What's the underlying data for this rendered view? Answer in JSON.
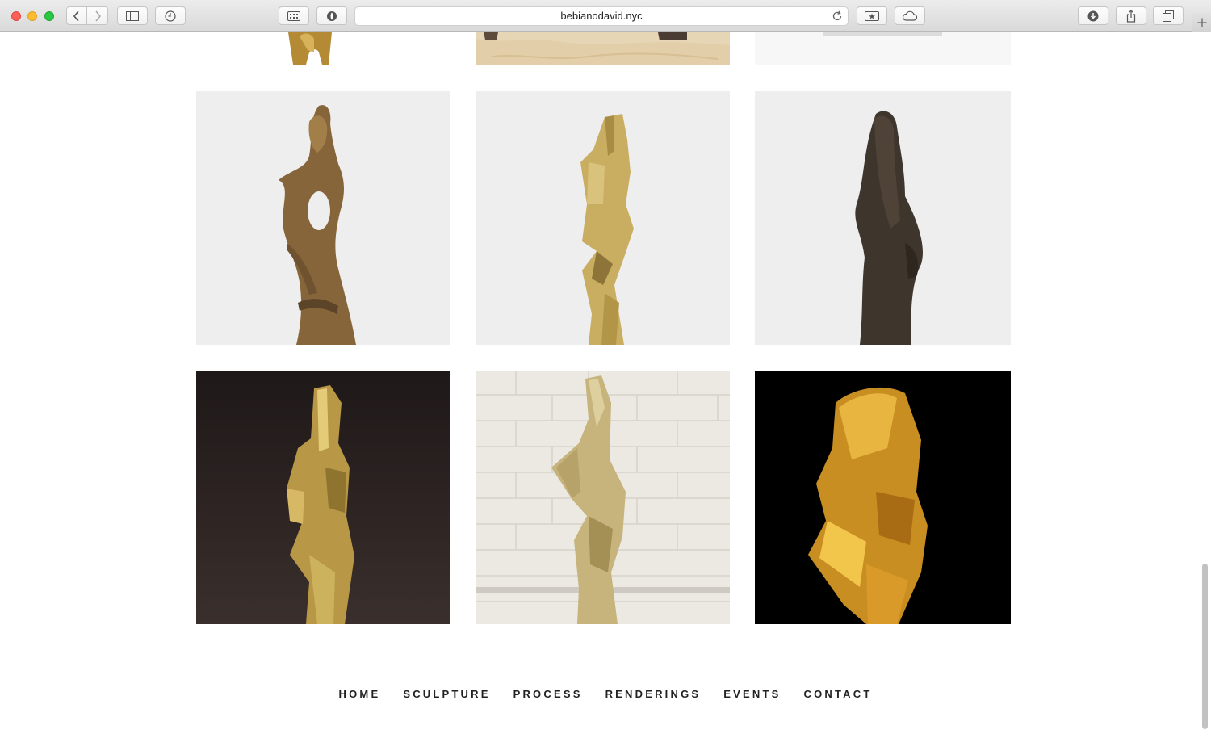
{
  "browser": {
    "url": "bebianodavid.nyc"
  },
  "gallery": {
    "tiles": [
      {
        "name": "sculpture-top-left",
        "bg": "#ffffff"
      },
      {
        "name": "sculpture-top-middle",
        "bg": "#e8d8b8"
      },
      {
        "name": "sculpture-top-right",
        "bg": "#f6f6f6"
      },
      {
        "name": "sculpture-bronze-figure-hole",
        "bg": "#eeeeee"
      },
      {
        "name": "sculpture-gold-cubist-small",
        "bg": "#eeeeee"
      },
      {
        "name": "sculpture-dark-bronze-veiled",
        "bg": "#eeeeee"
      },
      {
        "name": "sculpture-gold-cubist-dark-backdrop",
        "bg": "#2a2220"
      },
      {
        "name": "sculpture-gold-against-brick",
        "bg": "#e9e6df"
      },
      {
        "name": "sculpture-gold-on-black",
        "bg": "#000000"
      }
    ]
  },
  "footer_nav": {
    "home": "HOME",
    "sculpture": "SCULPTURE",
    "process": "PROCESS",
    "renderings": "RENDERINGS",
    "events": "EVENTS",
    "contact": "CONTACT"
  },
  "colors": {
    "accent_gold": "#c9a44c",
    "bronze": "#8a6a3a",
    "dark_bronze": "#3e352c"
  }
}
